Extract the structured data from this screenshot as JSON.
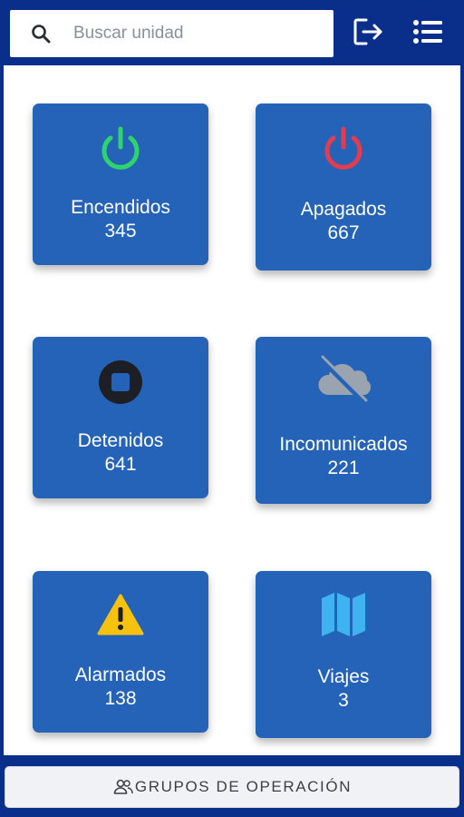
{
  "search": {
    "placeholder": "Buscar unidad",
    "icon": "search-icon"
  },
  "header": {
    "logout_icon": "logout-icon",
    "menu_icon": "list-menu-icon"
  },
  "tiles": [
    {
      "label": "Encendidos",
      "count": "345",
      "icon": "power-icon",
      "icon_color": "#2fd36b"
    },
    {
      "label": "Apagados",
      "count": "667",
      "icon": "power-icon",
      "icon_color": "#e23c4f"
    },
    {
      "label": "Detenidos",
      "count": "641",
      "icon": "stop-circle-icon",
      "icon_color": "#1e1f24"
    },
    {
      "label": "Incomunicados",
      "count": "221",
      "icon": "cloud-off-icon",
      "icon_color": "#9aa3b0"
    },
    {
      "label": "Alarmados",
      "count": "138",
      "icon": "warning-icon",
      "icon_color": "#f7c20f"
    },
    {
      "label": "Viajes",
      "count": "3",
      "icon": "map-icon",
      "icon_color": "#3fb3f2"
    }
  ],
  "footer": {
    "groups_label": "GRUPOS DE OPERACIÓN",
    "groups_icon": "users-icon"
  },
  "colors": {
    "brand": "#0a2f8a",
    "tile": "#2563b8"
  }
}
